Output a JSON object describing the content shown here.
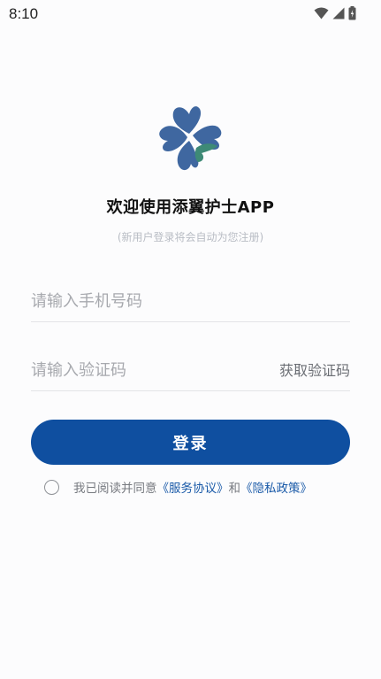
{
  "status_bar": {
    "time": "8:10",
    "icons": [
      "wifi-icon",
      "signal-icon",
      "battery-icon"
    ]
  },
  "logo": {
    "icon": "heart-clover-logo",
    "colors": [
      "#3f67a0",
      "#3e8a76"
    ]
  },
  "header": {
    "title": "欢迎使用添翼护士APP",
    "subtitle": "(新用户登录将会自动为您注册)"
  },
  "form": {
    "phone_placeholder": "请输入手机号码",
    "code_placeholder": "请输入验证码",
    "get_code_label": "获取验证码",
    "login_label": "登录"
  },
  "agreement": {
    "prefix": "我已阅读并同意",
    "service_link": "《服务协议》",
    "and": "和",
    "privacy_link": "《隐私政策》"
  },
  "colors": {
    "primary": "#0f4fa0",
    "link": "#1a5aa8",
    "placeholder": "#a7a9ae"
  }
}
